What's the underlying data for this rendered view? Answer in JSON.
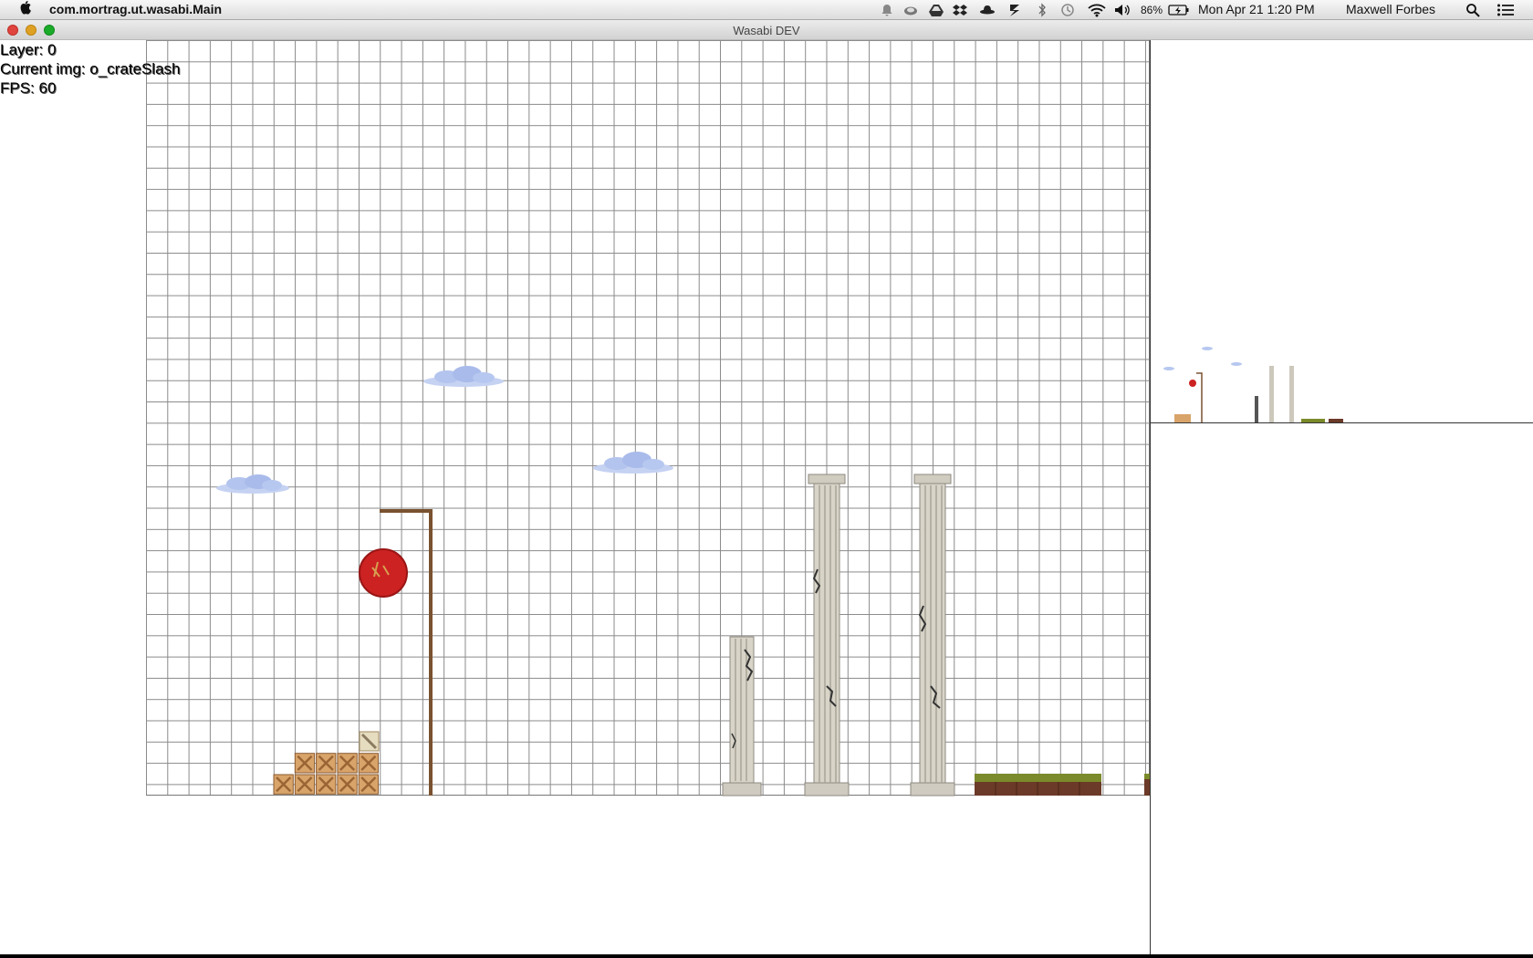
{
  "menubar": {
    "app_name": "com.mortrag.ut.wasabi.Main",
    "battery": "86%",
    "datetime": "Mon Apr 21  1:20 PM",
    "user": "Maxwell Forbes",
    "icons": [
      "apple-icon",
      "notification-icon",
      "cloud-icon",
      "drive-icon",
      "dropbox-icon",
      "hat-icon",
      "bolt-icon",
      "bluetooth-icon",
      "time-machine-icon",
      "wifi-icon",
      "volume-icon",
      "battery-icon",
      "spotlight-icon",
      "list-icon"
    ]
  },
  "window": {
    "title": "Wasabi DEV"
  },
  "hud": {
    "layer": "Layer: 0",
    "current_img": "Current img: o_crateSlash",
    "fps": "FPS: 60"
  },
  "colors": {
    "crate": "#d9a46a",
    "pole": "#7a5230",
    "ball": "#cc2222",
    "grass": "#7b8a2a",
    "dirt": "#6b3a28",
    "cloud": "#b7c8f0",
    "column": "#d8d4c8"
  }
}
